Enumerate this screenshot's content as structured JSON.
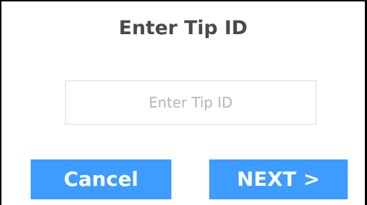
{
  "dialog": {
    "title": "Enter Tip ID",
    "tip_input": {
      "value": "",
      "placeholder": "Enter Tip ID"
    },
    "cancel_label": "Cancel",
    "next_label": "NEXT >"
  },
  "colors": {
    "button_bg": "#3d9cff",
    "button_text": "#ffffff",
    "title_text": "#4a4a4a",
    "placeholder_text": "#b5b5b5",
    "input_border": "#dcdcdc"
  }
}
